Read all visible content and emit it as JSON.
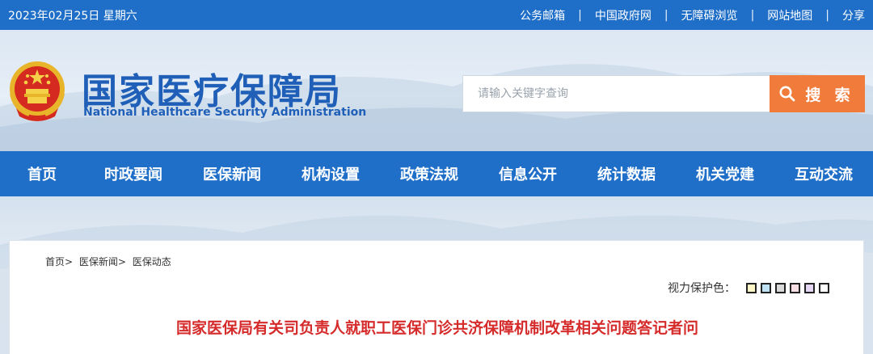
{
  "topbar": {
    "date": "2023年02月25日 星期六",
    "links": [
      "公务邮箱",
      "中国政府网",
      "无障碍浏览",
      "网站地图",
      "分享"
    ],
    "separator": "|"
  },
  "header": {
    "title_cn": "国家医疗保障局",
    "title_en": "National Healthcare Security Administration",
    "search": {
      "placeholder": "请输入关键字查询",
      "button_label": "搜 索"
    }
  },
  "nav": {
    "items": [
      "首页",
      "时政要闻",
      "医保新闻",
      "机构设置",
      "政策法规",
      "信息公开",
      "统计数据",
      "机关党建",
      "互动交流"
    ]
  },
  "content": {
    "breadcrumb": [
      "首页>",
      "医保新闻>",
      "医保动态"
    ],
    "vision_label": "视力保护色：",
    "vision_colors": [
      "#fff8c6",
      "#bfe3f5",
      "#d9d9d9",
      "#f9dfe6",
      "#e5d6f3",
      "#ffffff"
    ],
    "article_title": "国家医保局有关司负责人就职工医保门诊共济保障机制改革相关问题答记者问"
  },
  "colors": {
    "primary": "#1f6fc9",
    "accent": "#f07b3a",
    "title_red": "#d62b2b"
  }
}
